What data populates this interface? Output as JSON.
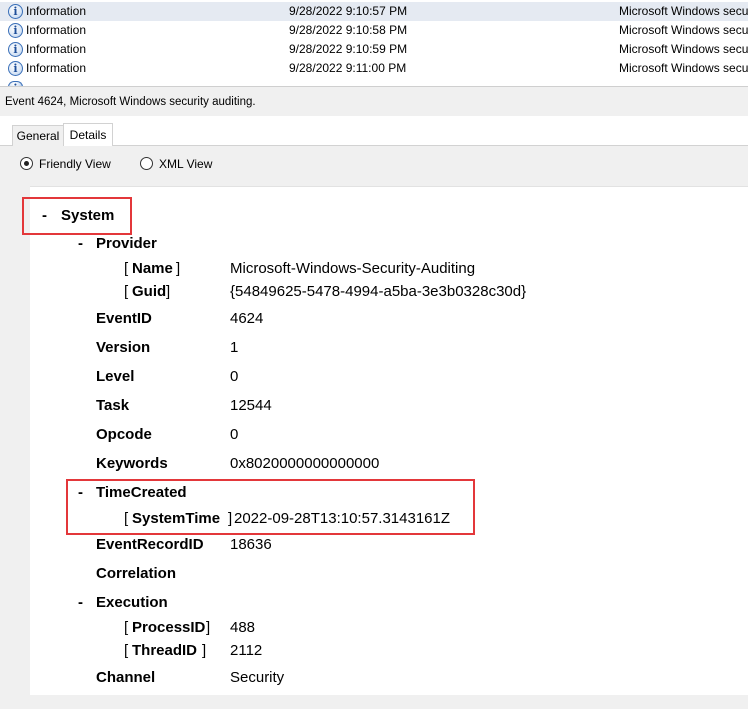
{
  "events": [
    {
      "level": "Information",
      "datetime": "9/28/2022 9:10:57 PM",
      "source": "Microsoft Windows secu",
      "selected": true
    },
    {
      "level": "Information",
      "datetime": "9/28/2022 9:10:58 PM",
      "source": "Microsoft Windows secu",
      "selected": false
    },
    {
      "level": "Information",
      "datetime": "9/28/2022 9:10:59 PM",
      "source": "Microsoft Windows secu",
      "selected": false
    },
    {
      "level": "Information",
      "datetime": "9/28/2022 9:11:00 PM",
      "source": "Microsoft Windows secu",
      "selected": false
    }
  ],
  "event_title": "Event 4624, Microsoft Windows security auditing.",
  "tabs": {
    "general": "General",
    "details": "Details"
  },
  "view": {
    "friendly": "Friendly View",
    "xml": "XML View",
    "selected": "friendly"
  },
  "system": {
    "toggle": "-",
    "label": "System",
    "provider": {
      "toggle": "-",
      "label": "Provider",
      "name_key": "Name",
      "name_value": "Microsoft-Windows-Security-Auditing",
      "guid_key": "Guid",
      "guid_value": "{54849625-5478-4994-a5ba-3e3b0328c30d}"
    },
    "eventid": {
      "key": "EventID",
      "value": "4624"
    },
    "version": {
      "key": "Version",
      "value": "1"
    },
    "level": {
      "key": "Level",
      "value": "0"
    },
    "task": {
      "key": "Task",
      "value": "12544"
    },
    "opcode": {
      "key": "Opcode",
      "value": "0"
    },
    "keywords": {
      "key": "Keywords",
      "value": "0x8020000000000000"
    },
    "timecreated": {
      "toggle": "-",
      "label": "TimeCreated",
      "systemtime_key": "SystemTime",
      "systemtime_value": "2022-09-28T13:10:57.3143161Z"
    },
    "eventrecordid": {
      "key": "EventRecordID",
      "value": "18636"
    },
    "correlation": {
      "key": "Correlation"
    },
    "execution": {
      "toggle": "-",
      "label": "Execution",
      "processid_key": "ProcessID",
      "processid_value": "488",
      "threadid_key": "ThreadID",
      "threadid_value": "2112"
    },
    "channel": {
      "key": "Channel",
      "value": "Security"
    }
  },
  "highlight_color": "#e3373a"
}
